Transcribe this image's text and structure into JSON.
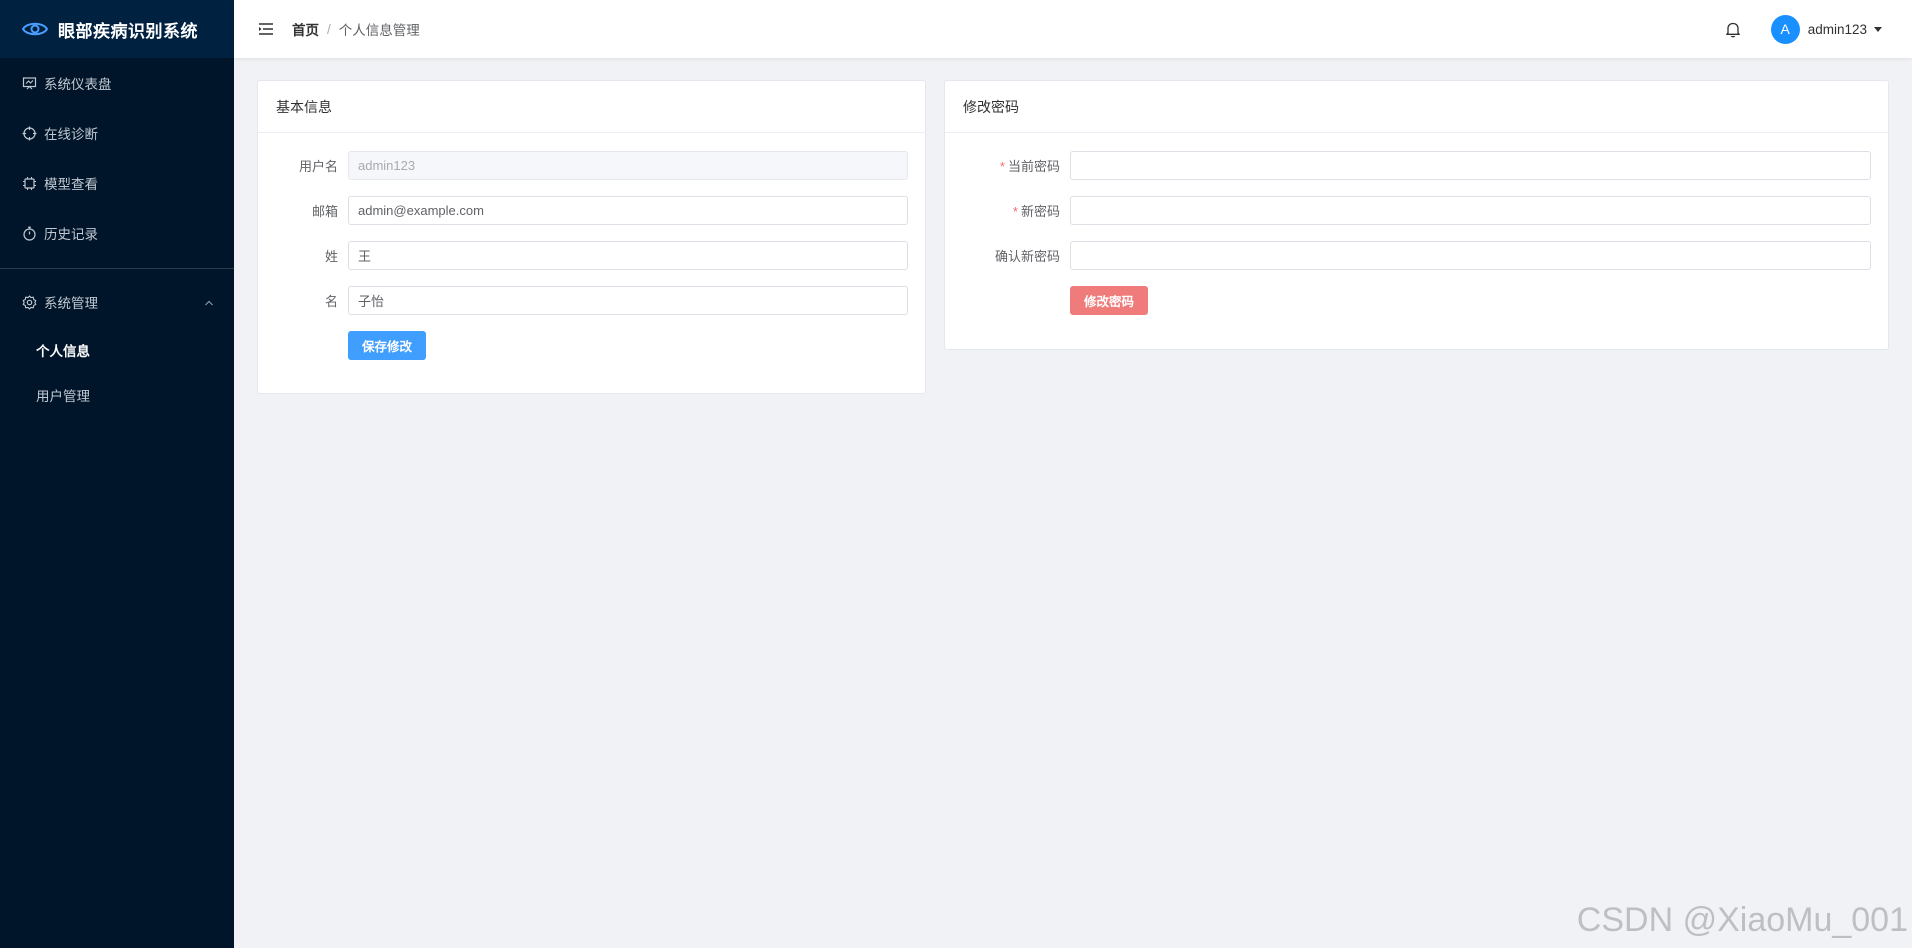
{
  "app": {
    "title": "眼部疾病识别系统"
  },
  "sidebar": {
    "items": [
      {
        "label": "系统仪表盘",
        "icon": "dashboard-icon"
      },
      {
        "label": "在线诊断",
        "icon": "crosshair-icon"
      },
      {
        "label": "模型查看",
        "icon": "cpu-icon"
      },
      {
        "label": "历史记录",
        "icon": "stopwatch-icon"
      }
    ],
    "submenu": {
      "label": "系统管理",
      "icon": "gear-icon",
      "items": [
        {
          "label": "个人信息",
          "active": true
        },
        {
          "label": "用户管理",
          "active": false
        }
      ]
    }
  },
  "header": {
    "breadcrumb": {
      "home": "首页",
      "separator": "/",
      "current": "个人信息管理"
    },
    "user": {
      "avatar_letter": "A",
      "name": "admin123"
    }
  },
  "basic_info": {
    "title": "基本信息",
    "fields": {
      "username": {
        "label": "用户名",
        "value": "admin123",
        "disabled": true
      },
      "email": {
        "label": "邮箱",
        "value": "admin@example.com"
      },
      "last_name": {
        "label": "姓",
        "value": "王"
      },
      "first_name": {
        "label": "名",
        "value": "子怡"
      }
    },
    "save_label": "保存修改"
  },
  "password": {
    "title": "修改密码",
    "fields": {
      "current": {
        "label": "当前密码",
        "required": true,
        "value": ""
      },
      "new": {
        "label": "新密码",
        "required": true,
        "value": ""
      },
      "confirm": {
        "label": "确认新密码",
        "required": false,
        "value": ""
      }
    },
    "submit_label": "修改密码"
  },
  "colors": {
    "sidebar_bg": "#001529",
    "primary": "#409eff",
    "danger": "#f07b7b",
    "avatar": "#1890ff"
  },
  "watermark": "CSDN @XiaoMu_001"
}
